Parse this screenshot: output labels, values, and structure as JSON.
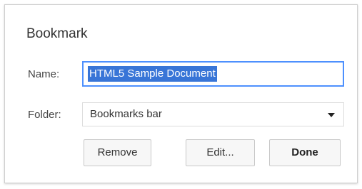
{
  "dialog": {
    "title": "Bookmark",
    "name_label": "Name:",
    "name_value": "HTML5 Sample Document",
    "folder_label": "Folder:",
    "folder_value": "Bookmarks bar",
    "buttons": {
      "remove": "Remove",
      "edit": "Edit...",
      "done": "Done"
    }
  },
  "colors": {
    "selection": "#3875d7",
    "focus_border": "#4d90fe"
  }
}
